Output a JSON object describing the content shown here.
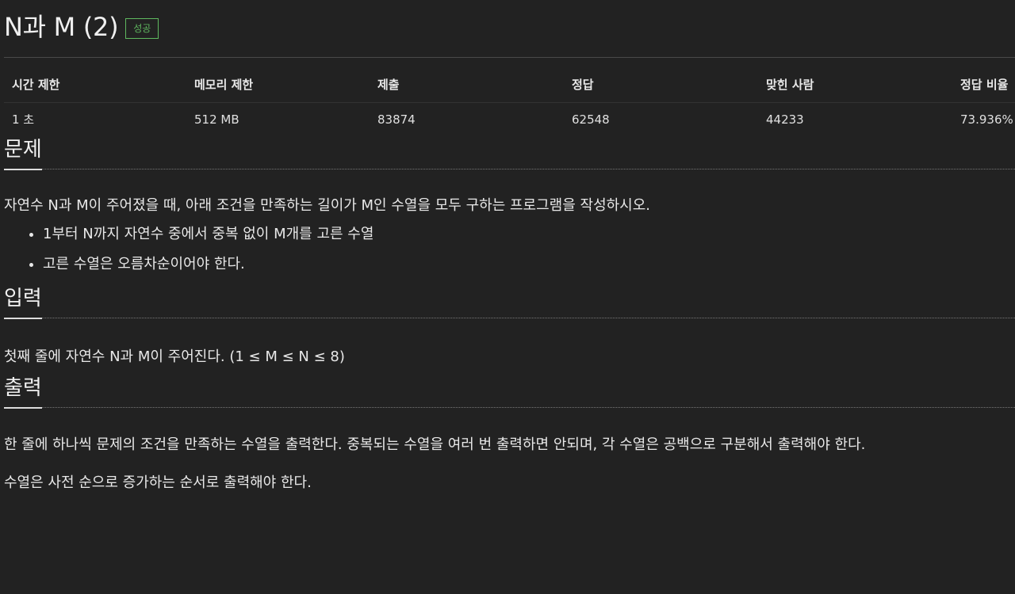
{
  "problem": {
    "title": "N과 M (2)",
    "badge": "성공"
  },
  "info_table": {
    "headers": [
      "시간 제한",
      "메모리 제한",
      "제출",
      "정답",
      "맞힌 사람",
      "정답 비율"
    ],
    "values": [
      "1 초",
      "512 MB",
      "83874",
      "62548",
      "44233",
      "73.936%"
    ]
  },
  "sections": {
    "description": {
      "heading": "문제",
      "text": "자연수 N과 M이 주어졌을 때, 아래 조건을 만족하는 길이가 M인 수열을 모두 구하는 프로그램을 작성하시오.",
      "conditions": [
        "1부터 N까지 자연수 중에서 중복 없이 M개를 고른 수열",
        "고른 수열은 오름차순이어야 한다."
      ]
    },
    "input": {
      "heading": "입력",
      "text": "첫째 줄에 자연수 N과 M이 주어진다. (1 ≤ M ≤ N ≤ 8)"
    },
    "output": {
      "heading": "출력",
      "text1": "한 줄에 하나씩 문제의 조건을 만족하는 수열을 출력한다. 중복되는 수열을 여러 번 출력하면 안되며, 각 수열은 공백으로 구분해서 출력해야 한다.",
      "text2": "수열은 사전 순으로 증가하는 순서로 출력해야 한다."
    }
  },
  "colors": {
    "background": "#222222",
    "badge_success": "#5fb85f",
    "text": "#e8e8e8"
  }
}
